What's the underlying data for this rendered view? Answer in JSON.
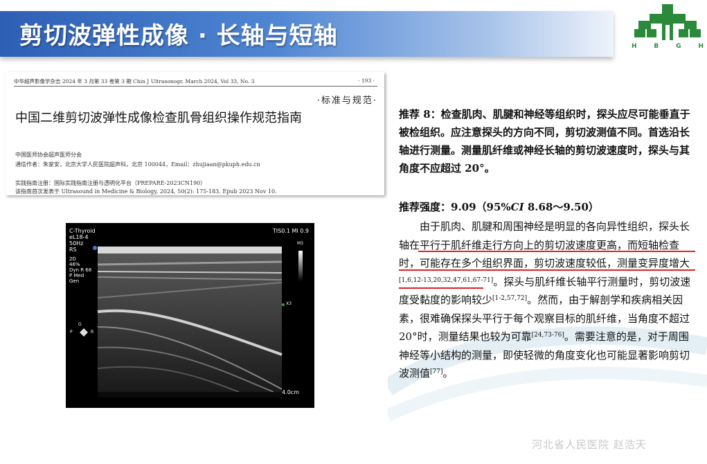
{
  "slide": {
    "title": "剪切波弹性成像 · 长轴与短轴",
    "footer": "河北省人民医院  赵浩天",
    "logo_letters": [
      "H",
      "B",
      "G",
      "H"
    ]
  },
  "paper": {
    "header_left": "中华超声影像学杂志 2024 年 3 月第 33 卷第 3 期  Chin J Ultrasonogr, March 2024, Vol 33, No. 3",
    "header_page": "· 193 ·",
    "section_tag": "·标准与规范·",
    "title": "中国二维剪切波弹性成像检查肌骨组织操作规范指南",
    "org": "中国医师协会超声医师分会",
    "contact": "通信作者：朱家安，北京大学人民医院超声科，北京 100044，Email：zhujiaan@pkuph.edu.cn",
    "registration": "实践指南注册：国际实践指南注册与透明化平台（PREPARE-2023CN190）",
    "first_pub": "该指南首次发表于 Ultrasound in Medicine & Biology, 2024, 50(2): 175-183. Epub 2023 Nov 10."
  },
  "ultrasound": {
    "preset": "C-Thyroid",
    "probe": "eL18-4",
    "freq": "50Hz",
    "rs": "RS",
    "mode": "2D",
    "gain": "46%",
    "dyn": "Dyn R 68",
    "pmed": "P Med",
    "gen": "Gen",
    "tis": "TIS0.1  MI 0.9",
    "depth": "4.0cm",
    "m3": "M3",
    "x3": "X3",
    "orient_g": "G",
    "orient_p": "P",
    "orient_r": "R"
  },
  "recommendation": {
    "text": "推荐 8：检查肌肉、肌腱和神经等组织时，探头应尽可能垂直于被检组织。应注意探头的方向不同，剪切波测值不同。首选沿长轴进行测量。测量肌纤维或神经长轴的剪切波速度时，探头与其角度不应超过 20°。",
    "strength_label": "推荐强度：9.09（95%",
    "strength_ci": "CI",
    "strength_range": " 8.68～9.50）"
  },
  "body": {
    "p1": "由于肌肉、肌腱和周围神经是明显的各向异性组织，",
    "p2": "探头长轴在平行于肌纤维走行方向上的剪切波速度更高，而短轴检查时，可能存在多个组织界面，剪切波速度较低",
    "p3": "，测量变异度增大",
    "sup1": "[1,6,12-13,20,32,47,61,67-71]",
    "p4": "。探头与肌纤维长轴平行测量时，剪切波速度受黏度的影响较少",
    "sup2": "[1-2,57,72]",
    "p5": "。然而，由于解剖学和疾病相关因素，很难确保探头平行于每个观察目标的肌纤维，当角度不超过 20°时，测量结果也较为可靠",
    "sup3": "[24,73-76]",
    "p6": "。需要注意的是，对于周围神经等小结构的测量，即使轻微的角度变化也可能显著影响剪切波测值",
    "sup4": "[77]",
    "p7": "。"
  },
  "colors": {
    "title_bar": "#2d5fb5",
    "underline": "#e02020",
    "logo_green": "#2a8a3a"
  }
}
